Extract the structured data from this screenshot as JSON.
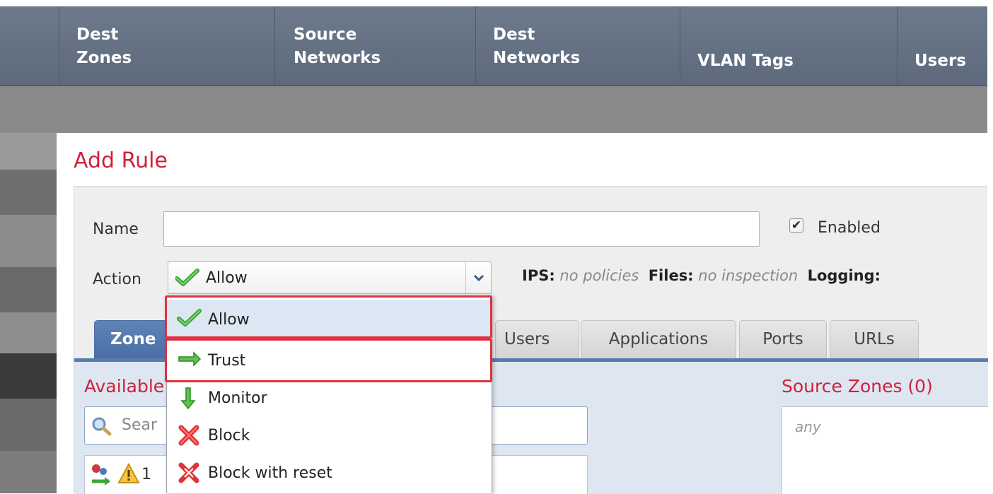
{
  "table_header": {
    "columns": [
      {
        "line1": "Dest",
        "line2": "Zones"
      },
      {
        "line1": "Source",
        "line2": "Networks"
      },
      {
        "line1": "Dest",
        "line2": "Networks"
      },
      {
        "line1": "",
        "line2": "VLAN Tags"
      },
      {
        "line1": "",
        "line2": "Users"
      }
    ]
  },
  "dialog": {
    "title": "Add Rule",
    "name_label": "Name",
    "name_value": "",
    "enabled_label": "Enabled",
    "enabled_checked": true,
    "action_label": "Action",
    "action_value": "Allow",
    "info": {
      "ips_label": "IPS:",
      "ips_value": "no policies",
      "files_label": "Files:",
      "files_value": "no inspection",
      "logging_label": "Logging:"
    },
    "tabs": [
      {
        "label": "Zones",
        "visible_text": "Zone",
        "active": true
      },
      {
        "label": "Users",
        "active": false
      },
      {
        "label": "Applications",
        "active": false
      },
      {
        "label": "Ports",
        "active": false
      },
      {
        "label": "URLs",
        "active": false
      }
    ],
    "available_label": "Available",
    "search_placeholder": "Sear",
    "list_item_text": "1",
    "source_zones_label": "Source Zones (0)",
    "source_zones_value": "any"
  },
  "action_dropdown": {
    "options": [
      {
        "label": "Allow",
        "icon": "check-icon",
        "selected": true
      },
      {
        "label": "Trust",
        "icon": "arrow-right-icon",
        "selected": false
      },
      {
        "label": "Monitor",
        "icon": "arrow-down-icon",
        "selected": false
      },
      {
        "label": "Block",
        "icon": "x-icon",
        "selected": false
      },
      {
        "label": "Block with reset",
        "icon": "x-reset-icon",
        "selected": false
      }
    ]
  },
  "colors": {
    "header_bg": "#627082",
    "accent_red": "#d1203a",
    "tab_active": "#4a6fa5",
    "highlight_red": "#e0303f",
    "check_green": "#3aa832"
  }
}
